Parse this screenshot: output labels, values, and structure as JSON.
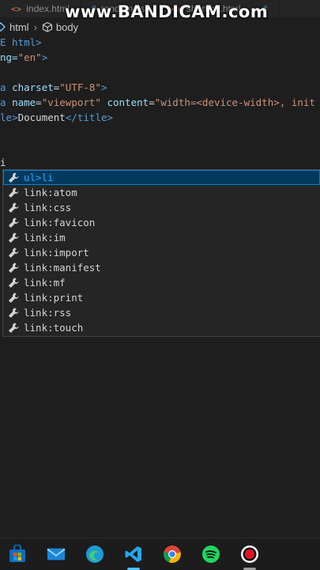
{
  "tabs": [
    {
      "label": "index.html",
      "icon": "html-file-icon"
    },
    {
      "label": "randam.css",
      "icon": "css-file-icon"
    },
    {
      "label": "shambu.html",
      "icon": "html-file-icon"
    },
    {
      "label": "#",
      "icon": "hash-file-icon"
    }
  ],
  "watermark": "www.BANDICAM.com",
  "breadcrumb": {
    "item1": "html",
    "item2": "body"
  },
  "code": {
    "l1": "E html>",
    "l2a": "ng=",
    "l2b": "\"en\"",
    "l2c": ">",
    "l4a": "a ",
    "l4b": "charset",
    "l4c": "=",
    "l4d": "\"UTF-8\"",
    "l4e": ">",
    "l5a": "a ",
    "l5b": "name",
    "l5c": "=",
    "l5d": "\"viewport\"",
    "l5e": " ",
    "l5f": "content",
    "l5g": "=",
    "l5h": "\"width=<device-width>, init",
    "l6a": "le",
    "l6b": ">",
    "l6c": "Document",
    "l6d": "</",
    "l6e": "title",
    "l6f": ">",
    "l9": "i"
  },
  "suggestions": [
    {
      "pre": "",
      "match": "ul>li",
      "post": ""
    },
    {
      "pre": "link:atom",
      "match": "",
      "post": ""
    },
    {
      "pre": "link:css",
      "match": "",
      "post": ""
    },
    {
      "pre": "link:favicon",
      "match": "",
      "post": ""
    },
    {
      "pre": "link:im",
      "match": "",
      "post": ""
    },
    {
      "pre": "link:import",
      "match": "",
      "post": ""
    },
    {
      "pre": "link:manifest",
      "match": "",
      "post": ""
    },
    {
      "pre": "link:mf",
      "match": "",
      "post": ""
    },
    {
      "pre": "link:print",
      "match": "",
      "post": ""
    },
    {
      "pre": "link:rss",
      "match": "",
      "post": ""
    },
    {
      "pre": "link:touch",
      "match": "",
      "post": ""
    }
  ],
  "taskbar": [
    {
      "name": "microsoft-store-icon"
    },
    {
      "name": "mail-icon"
    },
    {
      "name": "edge-browser-icon"
    },
    {
      "name": "vscode-icon"
    },
    {
      "name": "chrome-icon"
    },
    {
      "name": "spotify-icon"
    },
    {
      "name": "bandicam-record-icon"
    }
  ],
  "colors": {
    "accent": "#007fd4",
    "selection": "#04395e",
    "editor_bg": "#1e1e1e"
  }
}
